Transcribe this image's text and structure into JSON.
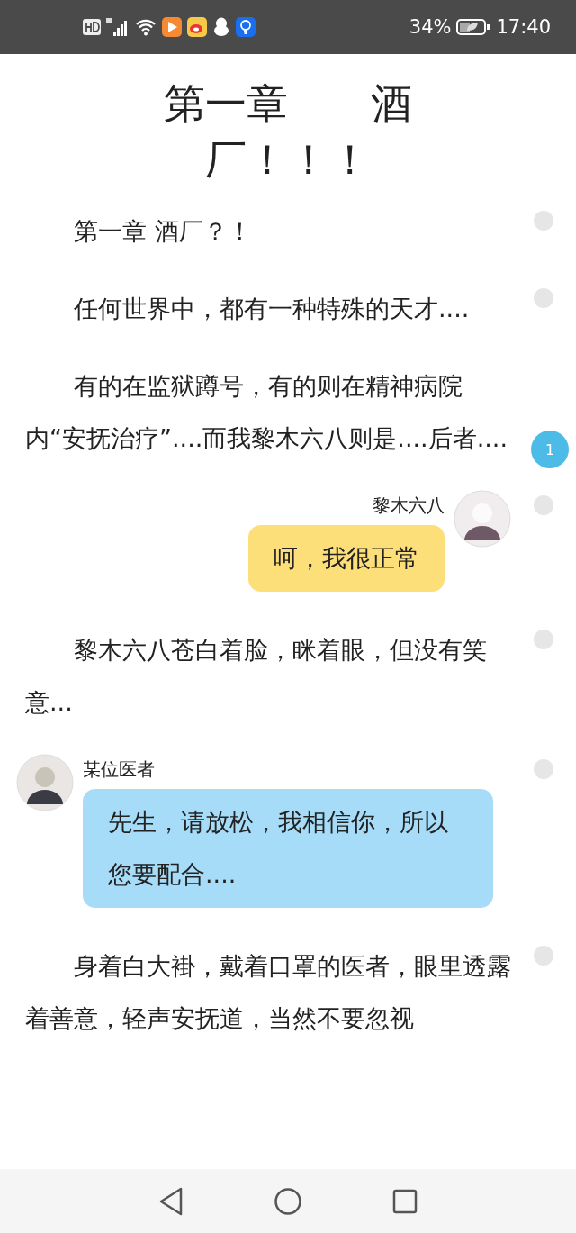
{
  "status_bar": {
    "battery": "34%",
    "time": "17:40"
  },
  "title": "第一章　　酒厂！！！",
  "blocks": [
    {
      "kind": "paragraph",
      "text": "第一章 酒厂？！"
    },
    {
      "kind": "paragraph",
      "text": "任何世界中，都有一种特殊的天才...."
    },
    {
      "kind": "paragraph",
      "text": "有的在监狱蹲号，有的则在精神病院内“安抚治疗”....而我黎木六八则是....后者....",
      "comments": "1"
    },
    {
      "kind": "chat-right",
      "speaker": "黎木六八",
      "text": "呵，我很正常",
      "color": "#fddf7a"
    },
    {
      "kind": "paragraph",
      "text": "黎木六八苍白着脸，眯着眼，但没有笑意..."
    },
    {
      "kind": "chat-left",
      "speaker": "某位医者",
      "text": "先生，请放松，我相信你，所以您要配合....",
      "color": "#a6dcf8"
    },
    {
      "kind": "paragraph",
      "text": "身着白大褂，戴着口罩的医者，眼里透露着善意，轻声安抚道，当然不要忽视"
    }
  ]
}
